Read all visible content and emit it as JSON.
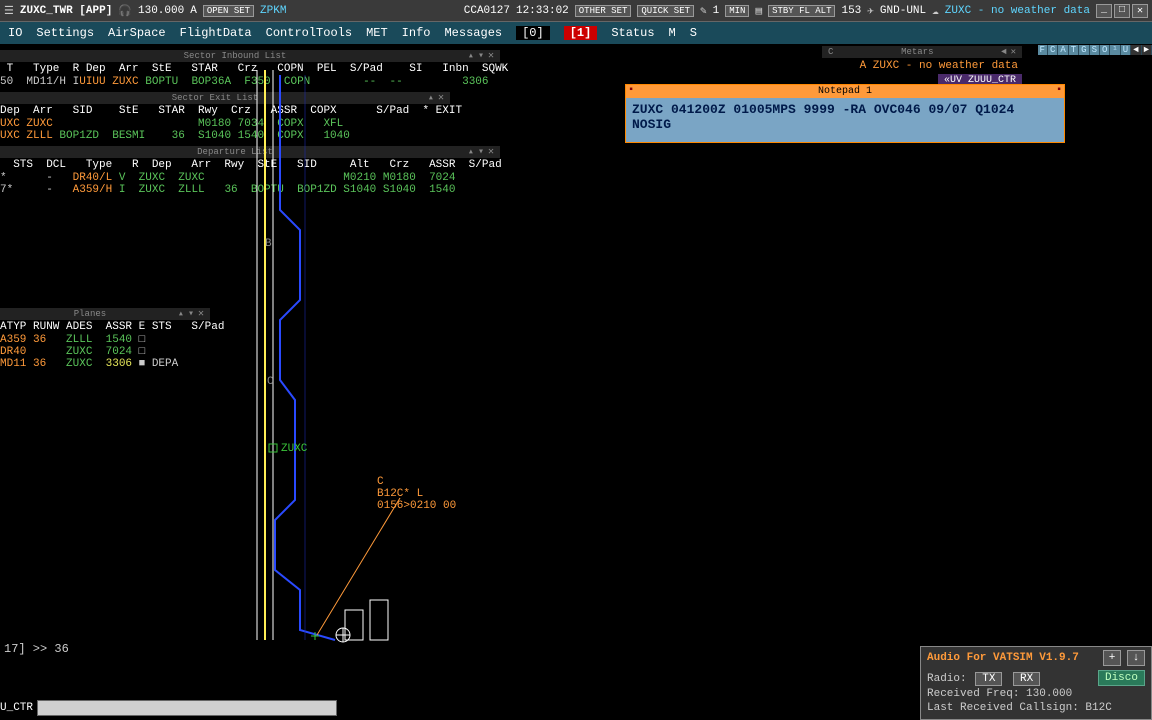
{
  "topbar": {
    "title": "ZUXC_TWR [APP]",
    "freq": "130.000",
    "mode": "A",
    "open_set": "OPEN SET",
    "open_code": "ZPKM",
    "cca": "CCA0127",
    "time": "12:33:02",
    "other_set": "OTHER SET",
    "quick_set": "QUICK SET",
    "scale": "1",
    "min": "MIN",
    "stby": "STBY FL ALT",
    "hdg": "153",
    "range": "GND-UNL",
    "weather": "ZUXC - no weather data"
  },
  "menubar": [
    "IO",
    "Settings",
    "AirSpace",
    "FlightData",
    "ControlTools",
    "MET",
    "Info",
    "Messages",
    "[0]",
    "[1]",
    "Status",
    "M",
    "S"
  ],
  "metars": {
    "title": "Metars",
    "text": "A ZUXC - no weather data",
    "uv": "«UV  ZUUU_CTR",
    "fcat": [
      "F",
      "C",
      "A",
      "T",
      "G",
      "S",
      "O",
      "¹",
      "U"
    ]
  },
  "notepad": {
    "title": "Notepad 1",
    "body": "ZUXC 041200Z 01005MPS 9999 -RA OVC046 09/07 Q1024 NOSIG"
  },
  "sector_inbound": {
    "title": "Sector Inbound List",
    "cols": " T   Type  R Dep  Arr  StE   STAR   Crz   COPN  PEL  S/Pad    SI   Inbn  SQWK",
    "rows": [
      {
        "a": "50  MD11/H I",
        "b": "UIUU ZUXC",
        "c": " BOPTU  BOP36A  F350  COPN        --  --         3306"
      }
    ]
  },
  "sector_exit": {
    "title": "Sector Exit List",
    "cols": "Dep  Arr   SID    StE   STAR  Rwy  Crz   ASSR  COPX      S/Pad  * EXIT",
    "rows": [
      {
        "a": "UXC ZUXC",
        "b": "                      M0180 7034  COPX   XFL"
      },
      {
        "a": "UXC ZLLL",
        "b": " BOP1ZD  BESMI    36  S1040 1540  COPX   1040"
      }
    ]
  },
  "departure": {
    "title": "Departure List",
    "cols": "  STS  DCL   Type   R  Dep   Arr  Rwy  StE   SID     Alt   Crz   ASSR  S/Pad",
    "rows": [
      {
        "a": "*      -   ",
        "b": "DR40/L",
        "c": " V  ZUXC  ZUXC                     M0210 M0180  7024"
      },
      {
        "a": "7*     -   ",
        "b": "A359/H",
        "c": " I  ZUXC  ZLLL   36  BOPTU  BOP1ZD S1040 S1040  1540"
      }
    ]
  },
  "planes": {
    "title": "Planes",
    "cols": "ATYP RUNW ADES  ASSR E STS   S/Pad",
    "rows": [
      {
        "a": "A359 36   ",
        "b": "ZLLL  1540",
        "c": " □"
      },
      {
        "a": "DR40      ",
        "b": "ZUXC  7024",
        "c": " □"
      },
      {
        "a": "MD11 36   ",
        "b": "ZUXC  ",
        "c2": "3306",
        "d": " ■ DEPA"
      }
    ]
  },
  "radar": {
    "fix_label": "ZUXC",
    "track": {
      "l1": "C",
      "l2": "B12C* L",
      "l3": "0156>0210 00"
    }
  },
  "cmd": "17] >> 36",
  "input": {
    "label": "U_CTR",
    "value": ""
  },
  "audio": {
    "title": "Audio For VATSIM V1.9.7",
    "radio_label": "Radio:",
    "tx": "TX",
    "rx": "RX",
    "disco": "Disco",
    "recv": "Received Freq: 130.000",
    "last": "Last Received Callsign: B12C"
  }
}
